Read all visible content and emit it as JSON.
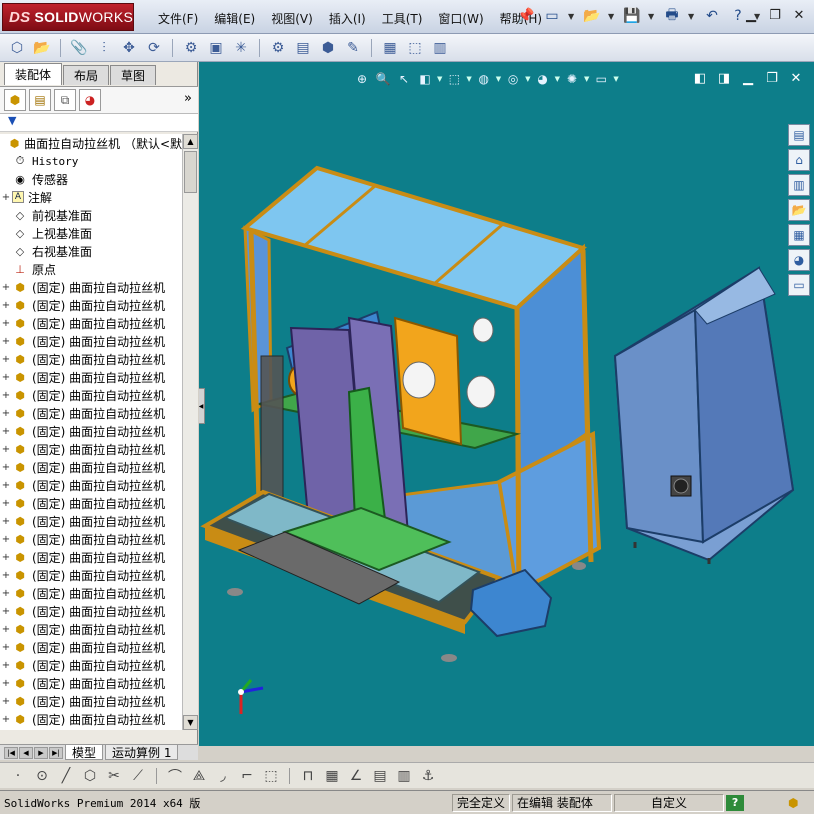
{
  "app": {
    "logo_ds": "DS",
    "logo_solid": "SOLID",
    "logo_works": "WORKS"
  },
  "menu": [
    "文件(F)",
    "编辑(E)",
    "视图(V)",
    "插入(I)",
    "工具(T)",
    "窗口(W)",
    "帮助(H)"
  ],
  "title_icons": [
    "pin-icon",
    "new-document-icon",
    "open-folder-icon",
    "save-icon",
    "print-icon",
    "undo-icon",
    "help-icon"
  ],
  "window_controls": [
    "minimize-icon",
    "restore-icon",
    "close-icon"
  ],
  "toolbar_icons": [
    "component-icon",
    "insert-component-icon",
    "paperclip-icon",
    "mate-icon",
    "move-icon",
    "rotate-icon",
    "smart-fastener-icon",
    "explode-icon",
    "exploded-line-icon",
    "interference-icon",
    "assembly-features-icon",
    "reference-geometry-icon",
    "new-motion-study-icon",
    "bill-of-materials-icon",
    "instant3d-icon",
    "large-assembly-icon",
    "options-icon"
  ],
  "left_panel": {
    "tabs": [
      "装配体",
      "布局",
      "草图"
    ],
    "active_tab": 0,
    "feature_manager_icons": [
      "feature-manager-icon",
      "property-manager-icon",
      "configuration-manager-icon",
      "display-manager-icon"
    ],
    "expand_label": "»",
    "filter_label": "▼",
    "tree": [
      {
        "kind": "root",
        "label": "曲面拉自动拉丝机 （默认<默"
      },
      {
        "kind": "history",
        "label": "History"
      },
      {
        "kind": "sensor",
        "label": "传感器"
      },
      {
        "kind": "annotation",
        "label": "注解",
        "expand": "+"
      },
      {
        "kind": "plane",
        "label": "前视基准面"
      },
      {
        "kind": "plane",
        "label": "上视基准面"
      },
      {
        "kind": "plane",
        "label": "右视基准面"
      },
      {
        "kind": "origin",
        "label": "原点"
      },
      {
        "kind": "part",
        "label": "(固定) 曲面拉自动拉丝机",
        "expand": "+"
      },
      {
        "kind": "part",
        "label": "(固定) 曲面拉自动拉丝机",
        "expand": "+"
      },
      {
        "kind": "part",
        "label": "(固定) 曲面拉自动拉丝机",
        "expand": "+"
      },
      {
        "kind": "part",
        "label": "(固定) 曲面拉自动拉丝机",
        "expand": "+"
      },
      {
        "kind": "part",
        "label": "(固定) 曲面拉自动拉丝机",
        "expand": "+"
      },
      {
        "kind": "part",
        "label": "(固定) 曲面拉自动拉丝机",
        "expand": "+"
      },
      {
        "kind": "part",
        "label": "(固定) 曲面拉自动拉丝机",
        "expand": "+"
      },
      {
        "kind": "part",
        "label": "(固定) 曲面拉自动拉丝机",
        "expand": "+"
      },
      {
        "kind": "part",
        "label": "(固定) 曲面拉自动拉丝机",
        "expand": "+"
      },
      {
        "kind": "part",
        "label": "(固定) 曲面拉自动拉丝机",
        "expand": "+"
      },
      {
        "kind": "part",
        "label": "(固定) 曲面拉自动拉丝机",
        "expand": "+"
      },
      {
        "kind": "part",
        "label": "(固定) 曲面拉自动拉丝机",
        "expand": "+"
      },
      {
        "kind": "part",
        "label": "(固定) 曲面拉自动拉丝机",
        "expand": "+"
      },
      {
        "kind": "part",
        "label": "(固定) 曲面拉自动拉丝机",
        "expand": "+"
      },
      {
        "kind": "part",
        "label": "(固定) 曲面拉自动拉丝机",
        "expand": "+"
      },
      {
        "kind": "part",
        "label": "(固定) 曲面拉自动拉丝机",
        "expand": "+"
      },
      {
        "kind": "part",
        "label": "(固定) 曲面拉自动拉丝机",
        "expand": "+"
      },
      {
        "kind": "part",
        "label": "(固定) 曲面拉自动拉丝机",
        "expand": "+"
      },
      {
        "kind": "part",
        "label": "(固定) 曲面拉自动拉丝机",
        "expand": "+"
      },
      {
        "kind": "part",
        "label": "(固定) 曲面拉自动拉丝机",
        "expand": "+"
      },
      {
        "kind": "part",
        "label": "(固定) 曲面拉自动拉丝机",
        "expand": "+"
      },
      {
        "kind": "part",
        "label": "(固定) 曲面拉自动拉丝机",
        "expand": "+"
      },
      {
        "kind": "part",
        "label": "(固定) 曲面拉自动拉丝机",
        "expand": "+"
      },
      {
        "kind": "part",
        "label": "(固定) 曲面拉自动拉丝机",
        "expand": "+"
      },
      {
        "kind": "part",
        "label": "(固定) 曲面拉自动拉丝机",
        "expand": "+"
      },
      {
        "kind": "part",
        "label": "(固定) 曲面拉自动拉丝机",
        "expand": "+"
      }
    ],
    "bottom_tabs": [
      "模型",
      "运动算例 1"
    ]
  },
  "viewport": {
    "background": "#0d7e8a",
    "hud_icons": [
      "zoom-to-fit-icon",
      "zoom-area-icon",
      "previous-view-icon",
      "section-view-icon",
      "view-orientation-icon",
      "display-style-icon",
      "hide-show-icon",
      "edit-appearance-icon",
      "apply-scene-icon",
      "view-settings-icon"
    ],
    "window_icons": [
      "prev-window-icon",
      "next-window-icon",
      "minimize-icon",
      "restore-icon",
      "close-icon"
    ],
    "task_pane_icons": [
      "solidworks-resources-icon",
      "home-icon",
      "design-library-icon",
      "file-explorer-icon",
      "view-palette-icon",
      "appearances-icon",
      "custom-properties-icon"
    ]
  },
  "sketch_toolbar_icons": [
    "point-icon",
    "circle-icon",
    "line-icon",
    "polygon-icon",
    "trim-icon",
    "extend-icon",
    "offset-icon",
    "mirror-icon",
    "fillet-icon",
    "corner-icon",
    "rectangle-icon",
    "dimension-icon",
    "grid-icon",
    "angle-icon",
    "table-icon",
    "hatch-icon",
    "anchor-icon"
  ],
  "status": {
    "product": "SolidWorks Premium 2014 x64 版",
    "definition": "完全定义",
    "editing": "在编辑 装配体",
    "units": "自定义",
    "help": "?",
    "rebuild_icon": "rebuild-icon"
  }
}
